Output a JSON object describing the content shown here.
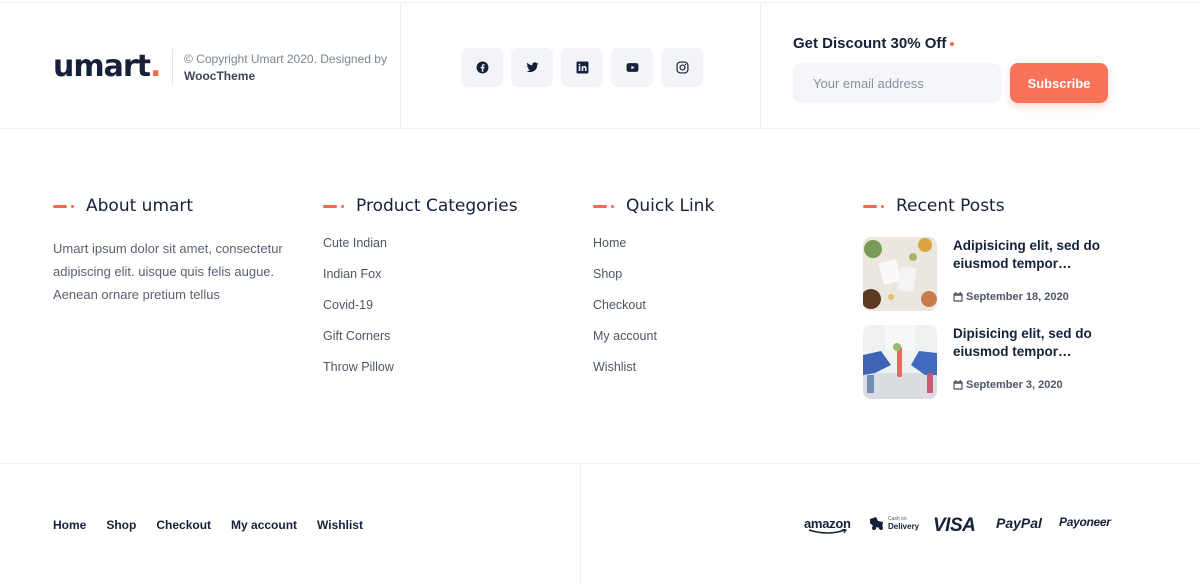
{
  "brand": {
    "logo": "umart",
    "logo_dot": ".",
    "copyright": "© Copyright Umart 2020. Designed by",
    "designer": "WoocTheme"
  },
  "social": [
    "facebook-icon",
    "twitter-icon",
    "linkedin-icon",
    "youtube-icon",
    "instagram-icon"
  ],
  "newsletter": {
    "title": "Get Discount 30% Off",
    "placeholder": "Your email address",
    "button": "Subscribe"
  },
  "about": {
    "title": "About umart",
    "text": "Umart ipsum dolor sit amet, consectetur adipiscing elit. uisque quis felis augue. Aenean ornare pretium tellus"
  },
  "categories": {
    "title": "Product Categories",
    "items": [
      "Cute Indian",
      "Indian Fox",
      "Covid-19",
      "Gift Corners",
      "Throw Pillow"
    ]
  },
  "quick": {
    "title": "Quick Link",
    "items": [
      "Home",
      "Shop",
      "Checkout",
      "My account",
      "Wishlist"
    ]
  },
  "recent": {
    "title": "Recent Posts",
    "posts": [
      {
        "title": "Adipisicing elit, sed do eiusmod tempor…",
        "date": "September 18, 2020"
      },
      {
        "title": "Dipisicing elit, sed do eiusmod tempor…",
        "date": "September 3, 2020"
      }
    ]
  },
  "bottom_nav": [
    "Home",
    "Shop",
    "Checkout",
    "My account",
    "Wishlist"
  ],
  "payments": {
    "amazon": "amazon",
    "cod_small": "Cash on",
    "cod": "Delivery",
    "visa": "VISA",
    "paypal": "PayPal",
    "payoneer": "Payoneer"
  },
  "colors": {
    "accent": "#f26b4a",
    "navy": "#15213a"
  }
}
